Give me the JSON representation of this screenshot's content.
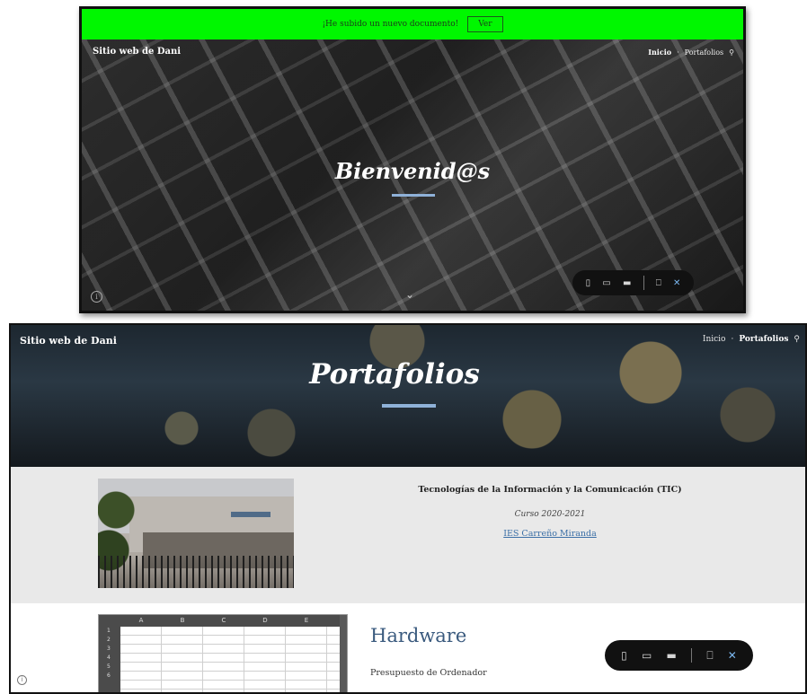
{
  "screenshot_top": {
    "announcement": {
      "text": "¡He subido un nuevo documento!",
      "button_label": "Ver",
      "bg_color": "#00f700"
    },
    "site_title": "Sitio web de Dani",
    "nav": {
      "items": [
        "Inicio",
        "·",
        "Portafolios"
      ],
      "active": "Inicio",
      "search_icon": "search-icon"
    },
    "hero": {
      "heading": "Bienvenid@s",
      "accent_color": "#8fb1d8"
    },
    "scroll_icon": "chevron-down-icon",
    "info_icon": "info-icon",
    "preview_toolbar": {
      "icons": [
        "phone-icon",
        "tablet-icon",
        "laptop-icon",
        "comment-icon",
        "close-icon"
      ]
    }
  },
  "screenshot_bottom": {
    "site_title": "Sitio web de Dani",
    "nav": {
      "items": [
        "Inicio",
        "·",
        "Portafolios"
      ],
      "active": "Portafolios",
      "search_icon": "search-icon"
    },
    "banner": {
      "heading": "Portafolios",
      "accent_color": "#8fb1d8"
    },
    "info_section": {
      "title": "Tecnologías de la Información y la Comunicación (TIC)",
      "subtitle": "Curso 2020-2021",
      "link": "IES Carreño Miranda"
    },
    "spreadsheet": {
      "columns": [
        "A",
        "B",
        "C",
        "D",
        "E"
      ],
      "rows": [
        "1",
        "2",
        "3",
        "4",
        "5",
        "6"
      ]
    },
    "hardware": {
      "title": "Hardware",
      "subtitle": "Presupuesto de Ordenador"
    },
    "preview_toolbar": {
      "icons": [
        "phone-icon",
        "tablet-icon",
        "laptop-icon",
        "comment-icon",
        "close-icon"
      ]
    },
    "info_icon": "info-icon"
  },
  "icons": {
    "search": "⚲",
    "chevron": "⌄",
    "info": "i",
    "phone": "▯",
    "tablet": "▭",
    "laptop": "▬",
    "comment": "⎕",
    "close": "✕"
  }
}
